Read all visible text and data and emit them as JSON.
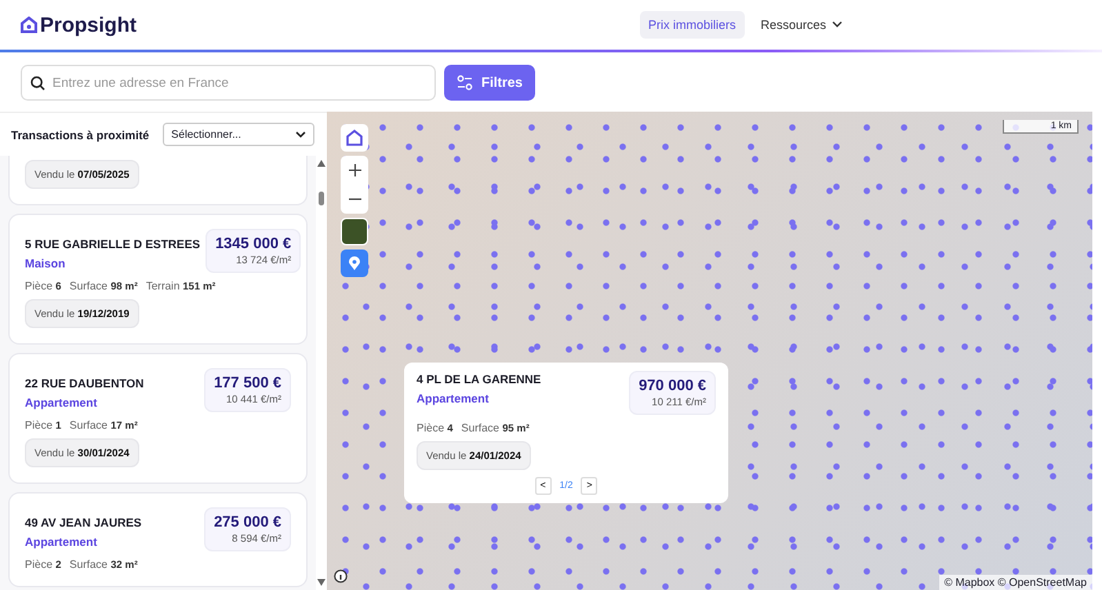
{
  "header": {
    "logo": "Propsight",
    "nav": [
      {
        "label": "Prix immobiliers",
        "selected": true,
        "kind": "link"
      },
      {
        "label": "Ressources",
        "selected": false,
        "kind": "menu"
      }
    ]
  },
  "search": {
    "placeholder": "Entrez une adresse en France",
    "filters_button": "Filtres"
  },
  "sidebar": {
    "title": "Transactions à proximité",
    "select": "Sélectionner...",
    "transactions": [
      {
        "sold": "Vendu le **07/05/2025**"
      },
      {
        "address": "5 RUE GABRIELLE D ESTREES",
        "type": "Maison",
        "price": "1345 000 €",
        "price_per_m2": "13 724 €/m²",
        "details": [
          {
            "label": "Pièce",
            "value": "6"
          },
          {
            "label": "Surface",
            "value": "98 m²"
          },
          {
            "label": "Terrain",
            "value": "151 m²"
          }
        ],
        "sold": "Vendu le **19/12/2019**"
      },
      {
        "address": "22 RUE DAUBENTON",
        "type": "Appartement",
        "price": "177 500 €",
        "price_per_m2": "10 441 €/m²",
        "details": [
          {
            "label": "Pièce",
            "value": "1"
          },
          {
            "label": "Surface",
            "value": "17 m²"
          }
        ],
        "sold": "Vendu le **30/01/2024**"
      },
      {
        "address": "49 AV JEAN JAURES",
        "type": "Appartement",
        "price": "275 000 €",
        "price_per_m2": "8 594 €/m²",
        "details": [
          {
            "label": "Pièce",
            "value": "2"
          },
          {
            "label": "Surface",
            "value": "32 m²"
          }
        ]
      }
    ]
  },
  "map": {
    "scale": "1 km",
    "attribution": "© Mapbox © OpenStreetMap",
    "popup": {
      "address": "4 PL DE LA GARENNE",
      "type": "Appartement",
      "price": "970 000 €",
      "price_per_m2": "10 211 €/m²",
      "details": [
        {
          "label": "Pièce",
          "value": "4"
        },
        {
          "label": "Surface",
          "value": "95 m²"
        }
      ],
      "sold": "Vendu le **24/01/2024**",
      "pager": {
        "prev": "<",
        "page": "1/2",
        "next": ">"
      }
    }
  }
}
